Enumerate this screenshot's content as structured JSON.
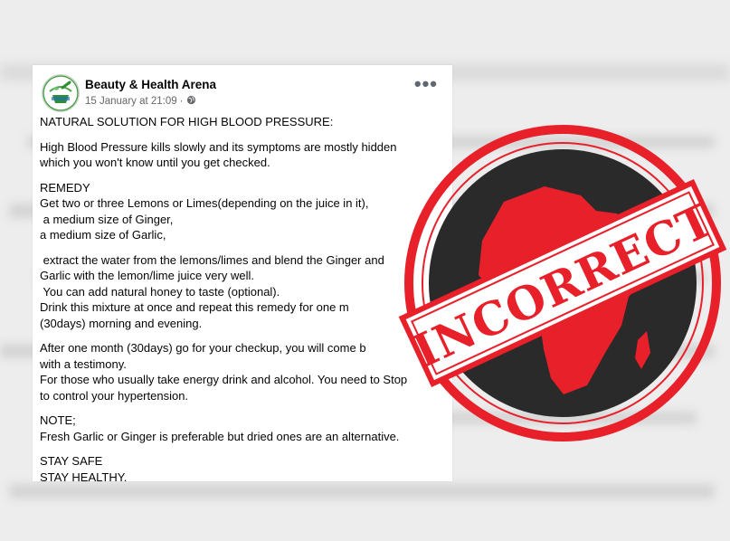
{
  "post": {
    "page_name": "Beauty & Health Arena",
    "date": "15 January at 21:09",
    "separator": "·",
    "more_label": "•••",
    "avatar_icon": "mortar-pestle-logo-icon",
    "title_line": "NATURAL SOLUTION FOR HIGH BLOOD PRESSURE:",
    "intro": [
      "High Blood Pressure kills slowly and its symptoms are mostly hidden",
      "which you won't know until you get checked."
    ],
    "remedy": [
      "REMEDY",
      "Get two or three Lemons or Limes(depending on the juice in it),",
      " a medium size of Ginger,",
      "a medium size of Garlic,"
    ],
    "steps": [
      " extract the water from the lemons/limes and blend the Ginger and",
      "Garlic with the lemon/lime juice very well.",
      " You can add natural honey to taste (optional).",
      "Drink this mixture at once and repeat this remedy for one m",
      "(30days) morning and evening."
    ],
    "after": [
      "After one month (30days) go for your checkup, you will come b",
      "with a testimony.",
      "For those who usually take energy drink and alcohol. You need to Stop",
      "to control your hypertension."
    ],
    "note": [
      "NOTE;",
      "Fresh Garlic or Ginger is preferable but dried ones are an alternative."
    ],
    "closing": [
      "STAY SAFE",
      "STAY HEALTHY."
    ]
  },
  "stamp": {
    "text": "INCORRECT",
    "color": "#e8202a",
    "disc_color": "#2a2a2a",
    "icon": "africa-map-icon"
  },
  "colors": {
    "text": "#050505",
    "meta": "#65676b"
  }
}
